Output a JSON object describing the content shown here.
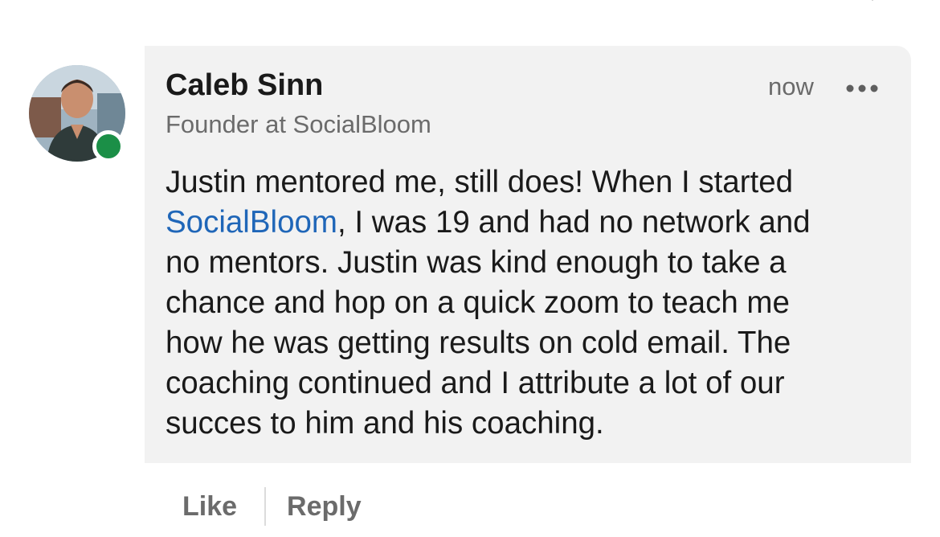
{
  "comment": {
    "author": {
      "name": "Caleb Sinn",
      "headline": "Founder at SocialBloom",
      "presence": "online",
      "presence_color": "#1b8f47"
    },
    "timestamp": "now",
    "menu_icon": "more-horizontal-icon",
    "body": {
      "line1": "Justin mentored me, still does! When I started",
      "mention": "SocialBloom",
      "line2_rest": ", I was 19 and had no network and",
      "line3": "no mentors. Justin was kind enough to take a",
      "line4": "chance and hop on a quick zoom to teach me",
      "line5": "how he was getting results on cold email. The",
      "line6": "coaching continued and I attribute a lot of our",
      "line7": "succes to him and his coaching."
    },
    "actions": {
      "like_label": "Like",
      "reply_label": "Reply"
    }
  },
  "colors": {
    "bubble_background": "#f2f2f2",
    "mention_link": "#1f66b8",
    "secondary_text": "#6b6b6b"
  }
}
